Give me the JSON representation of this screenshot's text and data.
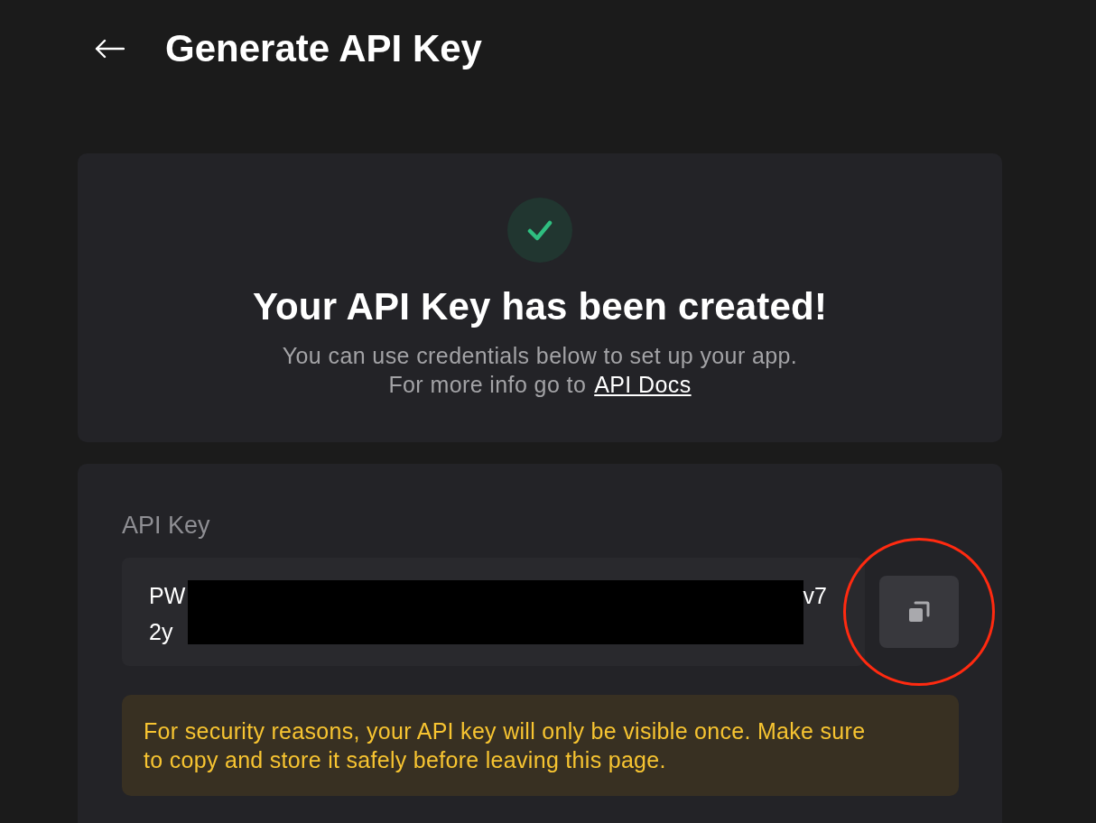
{
  "header": {
    "title": "Generate API Key"
  },
  "success_card": {
    "title": "Your API Key has been created!",
    "description_lines": [
      "You can use credentials below to set up your app.",
      "For more info go to"
    ],
    "link": "API Docs"
  },
  "api_key_card": {
    "label": "API Key",
    "key_field": {
      "lines": [
        {
          "start": "PW",
          "end": "v7"
        },
        {
          "start": "2y"
        }
      ],
      "redacted": true
    },
    "copy_button": {
      "highlighted": true
    },
    "warning": "For security reasons, your API key will only be visible once. Make sure to copy and store it safely before leaving this page."
  }
}
